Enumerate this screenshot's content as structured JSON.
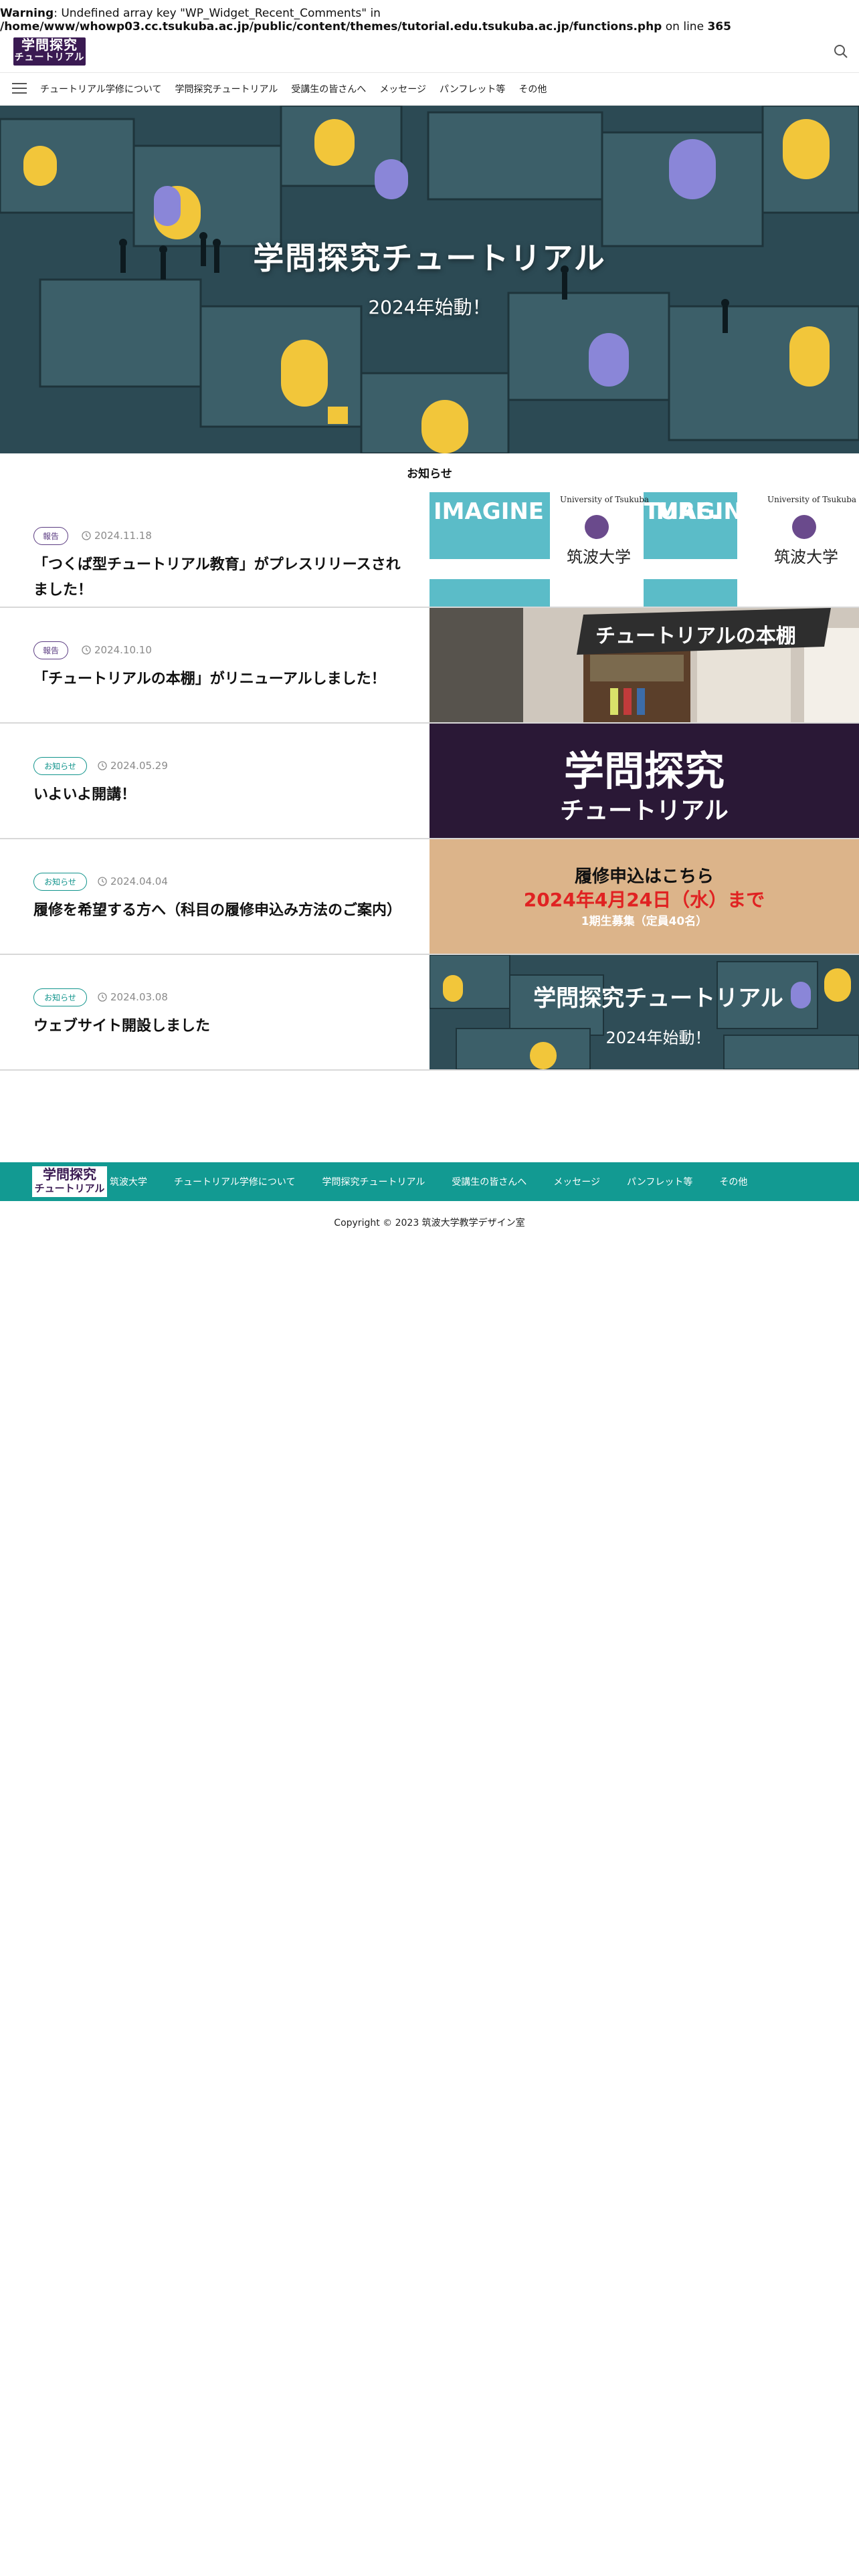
{
  "warning": {
    "label": "Warning",
    "text1": ": Undefined array key \"WP_Widget_Recent_Comments\" in",
    "path": "/home/www/whowp03.cc.tsukuba.ac.jp/public/content/themes/tutorial.edu.tsukuba.ac.jp/functions.php",
    "text2": " on line ",
    "line": "365"
  },
  "header": {
    "logo_line1": "学問探究",
    "logo_line2": "チュートリアル",
    "search_icon": "search-icon"
  },
  "nav": {
    "menu_icon": "hamburger-icon",
    "items": [
      "チュートリアル学修について",
      "学問探究チュートリアル",
      "受講生の皆さんへ",
      "メッセージ",
      "パンフレット等",
      "その他"
    ]
  },
  "hero": {
    "title": "学問探究チュートリアル",
    "subtitle": "2024年始動！"
  },
  "news": {
    "section_title": "お知らせ",
    "items": [
      {
        "category": "報告",
        "date": "2024.11.18",
        "title": "「つくば型チュートリアル教育」がプレスリリースされました！"
      },
      {
        "category": "報告",
        "date": "2024.10.10",
        "title": "「チュートリアルの本棚」がリニューアルしました！"
      },
      {
        "category": "お知らせ",
        "date": "2024.05.29",
        "title": "いよいよ開講！"
      },
      {
        "category": "お知らせ",
        "date": "2024.04.04",
        "title": "履修を希望する方へ（科目の履修申込み方法のご案内）"
      },
      {
        "category": "お知らせ",
        "date": "2024.03.08",
        "title": "ウェブサイト開設しました"
      }
    ],
    "thumbs": {
      "t1_tagline": "IMAGINE THE FUTURE.",
      "t1_univ": "筑波大学",
      "t1_univ_en": "University of Tsukuba",
      "t2_banner": "チュートリアルの本棚",
      "t3_line1": "学問探究",
      "t3_line2": "チュートリアル",
      "t4_line1": "履修申込はこちら",
      "t4_line2": "2024年4月24日（水）まで",
      "t4_line3": "1期生募集（定員40名）",
      "t5_title": "学問探究チュートリアル",
      "t5_sub": "2024年始動！"
    }
  },
  "footer": {
    "logo_line1": "学問探究",
    "logo_line2": "チュートリアル",
    "links": [
      "筑波大学",
      "チュートリアル学修について",
      "学問探究チュートリアル",
      "受講生の皆さんへ",
      "メッセージ",
      "パンフレット等",
      "その他"
    ],
    "copyright": "Copyright © 2023 筑波大学教学デザイン室"
  },
  "colors": {
    "brand_purple": "#3a1a52",
    "accent_teal": "#129a92",
    "report_badge": "#5b3c82"
  }
}
